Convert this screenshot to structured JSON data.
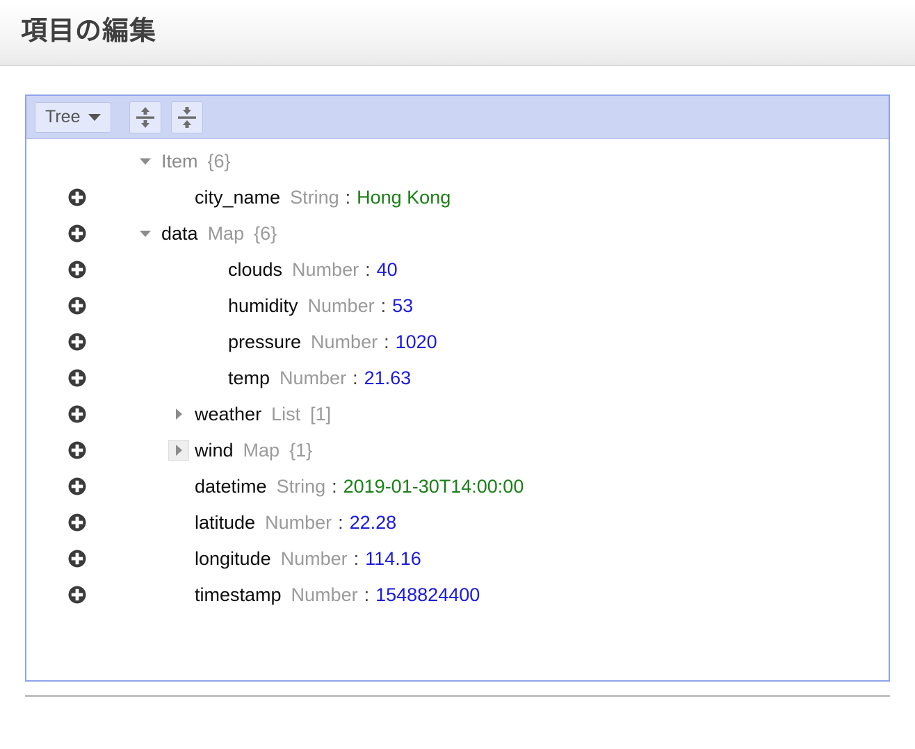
{
  "header": {
    "title": "項目の編集"
  },
  "toolbar": {
    "mode_label": "Tree",
    "mode_caret_icon": "chevron-down-icon",
    "expand_all_label": "Expand all",
    "collapse_all_label": "Collapse all"
  },
  "colors": {
    "panel_border": "#8ea4ea",
    "toolbar_bg": "#ccd5f3",
    "button_bg": "#e3e8fa",
    "string_value": "#1a8016",
    "number_value": "#1a1ae0",
    "type_label": "#9a9a9a",
    "key_label": "#0d0d0d"
  },
  "tree": [
    {
      "indent": 1,
      "toggle": "down",
      "toggle_hover": false,
      "has_action": false,
      "key": "Item",
      "key_muted": true,
      "type": "",
      "count": "{6}",
      "value": "",
      "value_kind": ""
    },
    {
      "indent": 2,
      "toggle": "none",
      "toggle_hover": false,
      "has_action": true,
      "key": "city_name",
      "key_muted": false,
      "type": "String",
      "count": "",
      "value": "Hong Kong",
      "value_kind": "string"
    },
    {
      "indent": 1,
      "toggle": "down",
      "toggle_hover": false,
      "has_action": true,
      "key": "data",
      "key_muted": false,
      "type": "Map",
      "count": "{6}",
      "value": "",
      "value_kind": ""
    },
    {
      "indent": 3,
      "toggle": "none",
      "toggle_hover": false,
      "has_action": true,
      "key": "clouds",
      "key_muted": false,
      "type": "Number",
      "count": "",
      "value": "40",
      "value_kind": "number"
    },
    {
      "indent": 3,
      "toggle": "none",
      "toggle_hover": false,
      "has_action": true,
      "key": "humidity",
      "key_muted": false,
      "type": "Number",
      "count": "",
      "value": "53",
      "value_kind": "number"
    },
    {
      "indent": 3,
      "toggle": "none",
      "toggle_hover": false,
      "has_action": true,
      "key": "pressure",
      "key_muted": false,
      "type": "Number",
      "count": "",
      "value": "1020",
      "value_kind": "number"
    },
    {
      "indent": 3,
      "toggle": "none",
      "toggle_hover": false,
      "has_action": true,
      "key": "temp",
      "key_muted": false,
      "type": "Number",
      "count": "",
      "value": "21.63",
      "value_kind": "number"
    },
    {
      "indent": 2,
      "toggle": "right",
      "toggle_hover": false,
      "has_action": true,
      "key": "weather",
      "key_muted": false,
      "type": "List",
      "count": "[1]",
      "value": "",
      "value_kind": ""
    },
    {
      "indent": 2,
      "toggle": "right",
      "toggle_hover": true,
      "has_action": true,
      "key": "wind",
      "key_muted": false,
      "type": "Map",
      "count": "{1}",
      "value": "",
      "value_kind": ""
    },
    {
      "indent": 2,
      "toggle": "none",
      "toggle_hover": false,
      "has_action": true,
      "key": "datetime",
      "key_muted": false,
      "type": "String",
      "count": "",
      "value": "2019-01-30T14:00:00",
      "value_kind": "string"
    },
    {
      "indent": 2,
      "toggle": "none",
      "toggle_hover": false,
      "has_action": true,
      "key": "latitude",
      "key_muted": false,
      "type": "Number",
      "count": "",
      "value": "22.28",
      "value_kind": "number"
    },
    {
      "indent": 2,
      "toggle": "none",
      "toggle_hover": false,
      "has_action": true,
      "key": "longitude",
      "key_muted": false,
      "type": "Number",
      "count": "",
      "value": "114.16",
      "value_kind": "number"
    },
    {
      "indent": 2,
      "toggle": "none",
      "toggle_hover": false,
      "has_action": true,
      "key": "timestamp",
      "key_muted": false,
      "type": "Number",
      "count": "",
      "value": "1548824400",
      "value_kind": "number"
    }
  ]
}
